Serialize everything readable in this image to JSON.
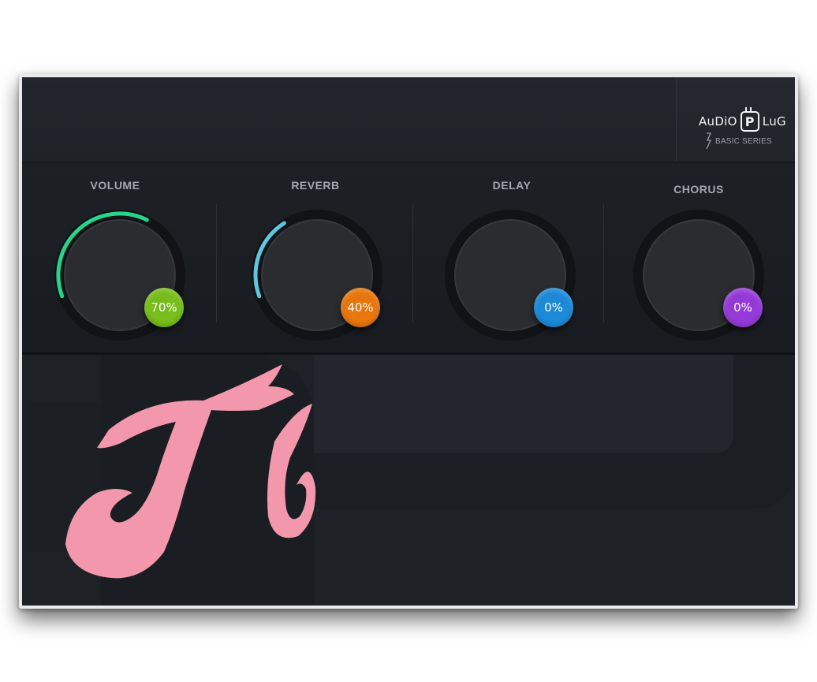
{
  "brand": {
    "logo_left": "AuDiO",
    "logo_mid": "P",
    "logo_right": "LuG",
    "series": "BASIC SERIES"
  },
  "knobs": [
    {
      "label": "VOLUME",
      "value": 70,
      "display": "70%",
      "badge_color": "#7bc41a",
      "arc_color": "#25d58a"
    },
    {
      "label": "REVERB",
      "value": 40,
      "display": "40%",
      "badge_color": "#f07a0c",
      "arc_color": "#5fc7dd"
    },
    {
      "label": "DELAY",
      "value": 0,
      "display": "0%",
      "badge_color": "#1c8ede",
      "arc_color": "#1c8ede"
    },
    {
      "label": "CHORUS",
      "value": 0,
      "display": "0%",
      "badge_color": "#9a3be0",
      "arc_color": "#9a3be0"
    }
  ],
  "icons": {
    "logo": "audio-plug-logo-icon",
    "series": "lightning-icon",
    "watermark": "brush-logo-icon"
  },
  "colors": {
    "panel": "#1f2329",
    "watermark": "#f398ac"
  }
}
